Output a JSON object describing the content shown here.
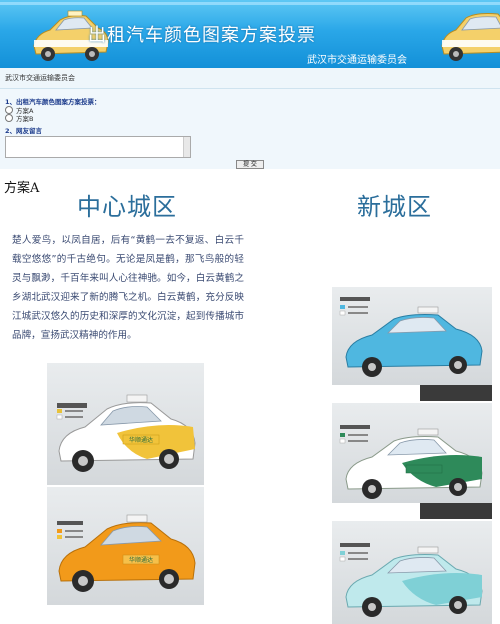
{
  "banner": {
    "title": "出租汽车颜色图案方案投票",
    "subtitle": "武汉市交通运输委员会"
  },
  "org_bar": {
    "label": "武汉市交通运输委员会"
  },
  "form": {
    "q1": "1、出租汽车颜色图案方案投票：",
    "options": [
      "方案A",
      "方案B"
    ],
    "q2": "2、网友留言",
    "submit_label": "提 交"
  },
  "scheme_label": "方案A",
  "center": {
    "heading": "中心城区",
    "paragraph": "楚人爱鸟，以凤自居，后有“黄鹤一去不复返、白云千载空悠悠”的千古绝句。无论是凤是鹤，那飞鸟般的轻灵与飘渺，千百年来叫人心往神驰。如今，白云黄鹤之乡湖北武汉迎来了新的腾飞之机。白云黄鹤，充分反映江城武汉悠久的历史和深厚的文化沉淀，起到传播城市品牌，宣扬武汉精神的作用。"
  },
  "new_area": {
    "heading": "新城区"
  },
  "car_label": "华顺通达",
  "colors": {
    "banner": "#2aa7e8",
    "heading": "#2b6e9b",
    "taxi_white_yellow": "#f1c33a",
    "taxi_orange": "#f29a1a",
    "taxi_blue": "#4fb7e0",
    "taxi_green": "#2e8a5a",
    "taxi_teal": "#7fd0d6"
  }
}
